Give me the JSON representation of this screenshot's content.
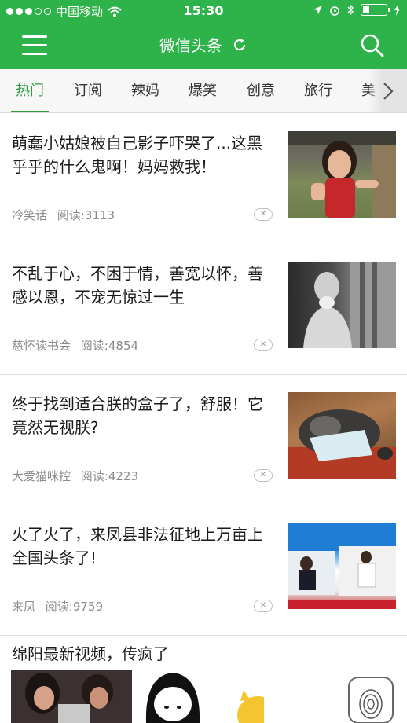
{
  "status": {
    "carrier": "中国移动",
    "time": "15:30"
  },
  "header": {
    "title": "微信头条",
    "icons": [
      "menu-icon",
      "refresh-icon",
      "search-icon"
    ]
  },
  "tabs": [
    {
      "label": "热门",
      "active": true
    },
    {
      "label": "订阅"
    },
    {
      "label": "辣妈"
    },
    {
      "label": "爆笑"
    },
    {
      "label": "创意"
    },
    {
      "label": "旅行"
    },
    {
      "label": "美"
    }
  ],
  "articles": [
    {
      "title": "萌蠢小姑娘被自己影子吓哭了...这黑乎乎的什么鬼啊！妈妈救我！",
      "source": "冷笑话",
      "reads": "阅读:3113"
    },
    {
      "title": "不乱于心，不困于情，善宽以怀，善感以恩，不宠无惊过一生",
      "source": "慈怀读书会",
      "reads": "阅读:4854"
    },
    {
      "title": "终于找到适合朕的盒子了，舒服！它竟然无视朕?",
      "source": "大爱猫咪控",
      "reads": "阅读:4223"
    },
    {
      "title": "火了火了，来凤县非法征地上万亩上全国头条了!",
      "source": "来凤",
      "reads": "阅读:9759"
    }
  ],
  "video_section": {
    "title": "绵阳最新视频，传疯了"
  },
  "colors": {
    "brand_green": "#2eb24a",
    "active_tab": "#2e9a43"
  }
}
